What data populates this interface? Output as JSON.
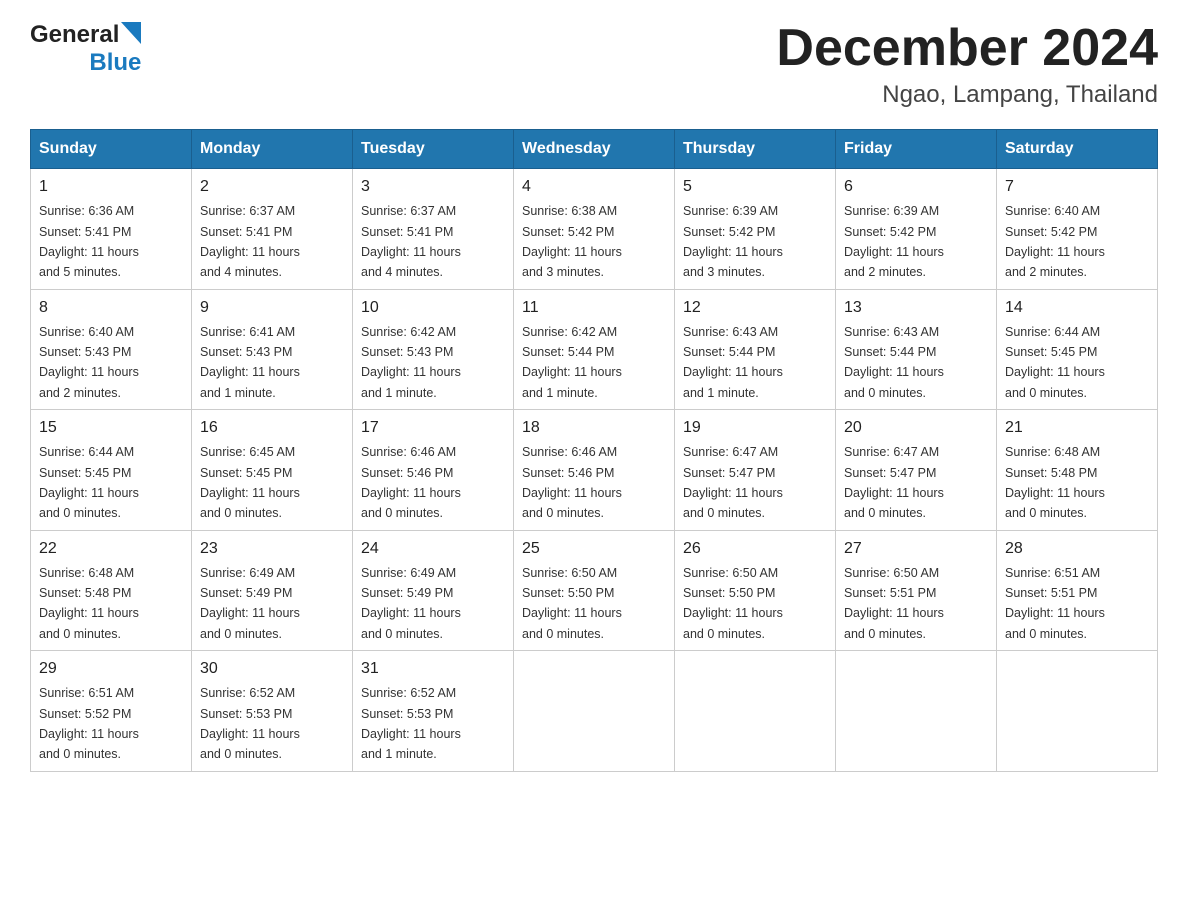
{
  "header": {
    "logo_general": "General",
    "logo_blue": "Blue",
    "month_title": "December 2024",
    "location": "Ngao, Lampang, Thailand"
  },
  "days_of_week": [
    "Sunday",
    "Monday",
    "Tuesday",
    "Wednesday",
    "Thursday",
    "Friday",
    "Saturday"
  ],
  "weeks": [
    {
      "days": [
        {
          "number": "1",
          "sunrise": "6:36 AM",
          "sunset": "5:41 PM",
          "daylight": "11 hours and 5 minutes."
        },
        {
          "number": "2",
          "sunrise": "6:37 AM",
          "sunset": "5:41 PM",
          "daylight": "11 hours and 4 minutes."
        },
        {
          "number": "3",
          "sunrise": "6:37 AM",
          "sunset": "5:41 PM",
          "daylight": "11 hours and 4 minutes."
        },
        {
          "number": "4",
          "sunrise": "6:38 AM",
          "sunset": "5:42 PM",
          "daylight": "11 hours and 3 minutes."
        },
        {
          "number": "5",
          "sunrise": "6:39 AM",
          "sunset": "5:42 PM",
          "daylight": "11 hours and 3 minutes."
        },
        {
          "number": "6",
          "sunrise": "6:39 AM",
          "sunset": "5:42 PM",
          "daylight": "11 hours and 2 minutes."
        },
        {
          "number": "7",
          "sunrise": "6:40 AM",
          "sunset": "5:42 PM",
          "daylight": "11 hours and 2 minutes."
        }
      ]
    },
    {
      "days": [
        {
          "number": "8",
          "sunrise": "6:40 AM",
          "sunset": "5:43 PM",
          "daylight": "11 hours and 2 minutes."
        },
        {
          "number": "9",
          "sunrise": "6:41 AM",
          "sunset": "5:43 PM",
          "daylight": "11 hours and 1 minute."
        },
        {
          "number": "10",
          "sunrise": "6:42 AM",
          "sunset": "5:43 PM",
          "daylight": "11 hours and 1 minute."
        },
        {
          "number": "11",
          "sunrise": "6:42 AM",
          "sunset": "5:44 PM",
          "daylight": "11 hours and 1 minute."
        },
        {
          "number": "12",
          "sunrise": "6:43 AM",
          "sunset": "5:44 PM",
          "daylight": "11 hours and 1 minute."
        },
        {
          "number": "13",
          "sunrise": "6:43 AM",
          "sunset": "5:44 PM",
          "daylight": "11 hours and 0 minutes."
        },
        {
          "number": "14",
          "sunrise": "6:44 AM",
          "sunset": "5:45 PM",
          "daylight": "11 hours and 0 minutes."
        }
      ]
    },
    {
      "days": [
        {
          "number": "15",
          "sunrise": "6:44 AM",
          "sunset": "5:45 PM",
          "daylight": "11 hours and 0 minutes."
        },
        {
          "number": "16",
          "sunrise": "6:45 AM",
          "sunset": "5:45 PM",
          "daylight": "11 hours and 0 minutes."
        },
        {
          "number": "17",
          "sunrise": "6:46 AM",
          "sunset": "5:46 PM",
          "daylight": "11 hours and 0 minutes."
        },
        {
          "number": "18",
          "sunrise": "6:46 AM",
          "sunset": "5:46 PM",
          "daylight": "11 hours and 0 minutes."
        },
        {
          "number": "19",
          "sunrise": "6:47 AM",
          "sunset": "5:47 PM",
          "daylight": "11 hours and 0 minutes."
        },
        {
          "number": "20",
          "sunrise": "6:47 AM",
          "sunset": "5:47 PM",
          "daylight": "11 hours and 0 minutes."
        },
        {
          "number": "21",
          "sunrise": "6:48 AM",
          "sunset": "5:48 PM",
          "daylight": "11 hours and 0 minutes."
        }
      ]
    },
    {
      "days": [
        {
          "number": "22",
          "sunrise": "6:48 AM",
          "sunset": "5:48 PM",
          "daylight": "11 hours and 0 minutes."
        },
        {
          "number": "23",
          "sunrise": "6:49 AM",
          "sunset": "5:49 PM",
          "daylight": "11 hours and 0 minutes."
        },
        {
          "number": "24",
          "sunrise": "6:49 AM",
          "sunset": "5:49 PM",
          "daylight": "11 hours and 0 minutes."
        },
        {
          "number": "25",
          "sunrise": "6:50 AM",
          "sunset": "5:50 PM",
          "daylight": "11 hours and 0 minutes."
        },
        {
          "number": "26",
          "sunrise": "6:50 AM",
          "sunset": "5:50 PM",
          "daylight": "11 hours and 0 minutes."
        },
        {
          "number": "27",
          "sunrise": "6:50 AM",
          "sunset": "5:51 PM",
          "daylight": "11 hours and 0 minutes."
        },
        {
          "number": "28",
          "sunrise": "6:51 AM",
          "sunset": "5:51 PM",
          "daylight": "11 hours and 0 minutes."
        }
      ]
    },
    {
      "days": [
        {
          "number": "29",
          "sunrise": "6:51 AM",
          "sunset": "5:52 PM",
          "daylight": "11 hours and 0 minutes."
        },
        {
          "number": "30",
          "sunrise": "6:52 AM",
          "sunset": "5:53 PM",
          "daylight": "11 hours and 0 minutes."
        },
        {
          "number": "31",
          "sunrise": "6:52 AM",
          "sunset": "5:53 PM",
          "daylight": "11 hours and 1 minute."
        },
        null,
        null,
        null,
        null
      ]
    }
  ],
  "labels": {
    "sunrise_prefix": "Sunrise: ",
    "sunset_prefix": "Sunset: ",
    "daylight_prefix": "Daylight: "
  },
  "colors": {
    "header_bg": "#2176ae",
    "header_text": "#ffffff",
    "border": "#cccccc"
  }
}
